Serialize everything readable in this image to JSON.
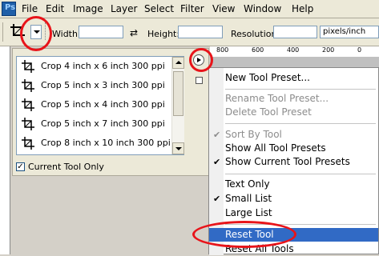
{
  "menubar": {
    "items": [
      "File",
      "Edit",
      "Image",
      "Layer",
      "Select",
      "Filter",
      "View",
      "Window",
      "Help"
    ]
  },
  "options_bar": {
    "width_label": "Width:",
    "width_value": "",
    "height_label": "Height:",
    "height_value": "",
    "resolution_label": "Resolution:",
    "resolution_value": "",
    "resolution_unit": "pixels/inch"
  },
  "ruler": {
    "ticks": [
      "800",
      "600",
      "400",
      "200",
      "0"
    ]
  },
  "preset_panel": {
    "presets": [
      "Crop 4 inch x 6 inch 300 ppi",
      "Crop 5 inch x 3 inch 300 ppi",
      "Crop 5 inch x 4 inch 300 ppi",
      "Crop 5 inch x 7 inch 300 ppi",
      "Crop 8 inch x 10 inch 300 ppi"
    ],
    "current_tool_only_label": "Current Tool Only",
    "current_tool_only_checked": true
  },
  "context_menu": {
    "items": [
      {
        "label": "New Tool Preset...",
        "enabled": true,
        "checked": false
      },
      {
        "label": "Rename Tool Preset...",
        "enabled": false,
        "checked": false
      },
      {
        "label": "Delete Tool Preset",
        "enabled": false,
        "checked": false
      },
      {
        "label": "Sort By Tool",
        "enabled": false,
        "checked": true
      },
      {
        "label": "Show All Tool Presets",
        "enabled": true,
        "checked": false
      },
      {
        "label": "Show Current Tool Presets",
        "enabled": true,
        "checked": true
      },
      {
        "label": "Text Only",
        "enabled": true,
        "checked": false
      },
      {
        "label": "Small List",
        "enabled": true,
        "checked": true
      },
      {
        "label": "Large List",
        "enabled": true,
        "checked": false
      },
      {
        "label": "Reset Tool",
        "enabled": true,
        "checked": false,
        "highlighted": true
      },
      {
        "label": "Reset All Tools",
        "enabled": true,
        "checked": false
      }
    ]
  },
  "colors": {
    "highlight": "#316ac5",
    "annotation": "#e8141a",
    "chrome": "#ece9d8"
  },
  "icons": {
    "crop_tool": "crop-icon",
    "panel_menu": "play-arrow-icon"
  }
}
